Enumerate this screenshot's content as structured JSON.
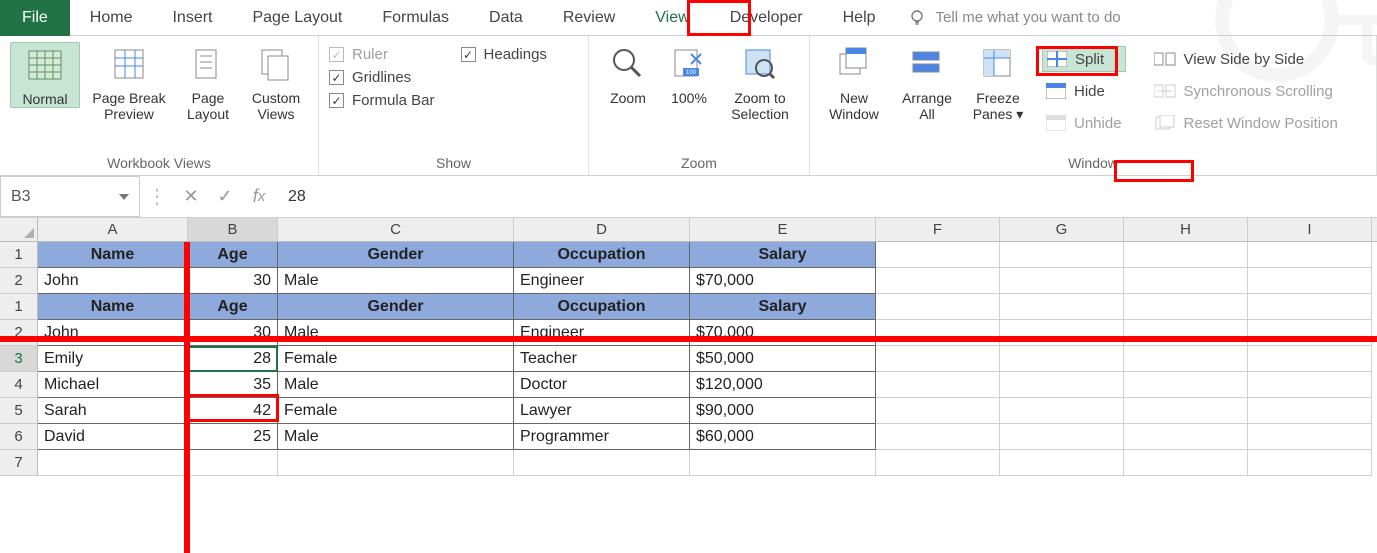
{
  "tabs": {
    "file": "File",
    "home": "Home",
    "insert": "Insert",
    "page_layout": "Page Layout",
    "formulas": "Formulas",
    "data": "Data",
    "review": "Review",
    "view": "View",
    "developer": "Developer",
    "help": "Help",
    "tell_me": "Tell me what you want to do"
  },
  "ribbon": {
    "workbook_views": {
      "label": "Workbook Views",
      "normal": "Normal",
      "page_break": "Page Break Preview",
      "page_layout": "Page Layout",
      "custom": "Custom Views"
    },
    "show": {
      "label": "Show",
      "ruler": "Ruler",
      "gridlines": "Gridlines",
      "formula_bar": "Formula Bar",
      "headings": "Headings"
    },
    "zoom": {
      "label": "Zoom",
      "zoom": "Zoom",
      "p100": "100%",
      "to_sel": "Zoom to Selection"
    },
    "window": {
      "label": "Window",
      "new_window": "New Window",
      "arrange_all": "Arrange All",
      "freeze": "Freeze Panes",
      "split": "Split",
      "hide": "Hide",
      "unhide": "Unhide",
      "side_by_side": "View Side by Side",
      "sync_scroll": "Synchronous Scrolling",
      "reset_pos": "Reset Window Position"
    }
  },
  "formula_bar": {
    "name_box": "B3",
    "value": "28"
  },
  "columns": [
    "A",
    "B",
    "C",
    "D",
    "E",
    "F",
    "G",
    "H",
    "I"
  ],
  "headers": [
    "Name",
    "Age",
    "Gender",
    "Occupation",
    "Salary"
  ],
  "rows": [
    {
      "name": "John",
      "age": "30",
      "gender": "Male",
      "occupation": "Engineer",
      "salary": "$70,000"
    },
    {
      "name": "Emily",
      "age": "28",
      "gender": "Female",
      "occupation": "Teacher",
      "salary": "$50,000"
    },
    {
      "name": "Michael",
      "age": "35",
      "gender": "Male",
      "occupation": "Doctor",
      "salary": "$120,000"
    },
    {
      "name": "Sarah",
      "age": "42",
      "gender": "Female",
      "occupation": "Lawyer",
      "salary": "$90,000"
    },
    {
      "name": "David",
      "age": "25",
      "gender": "Male",
      "occupation": "Programmer",
      "salary": "$60,000"
    }
  ],
  "top_pane_rows": [
    "1",
    "2"
  ],
  "bottom_pane_rows": [
    "1",
    "2",
    "3",
    "4",
    "5",
    "6",
    "7"
  ]
}
